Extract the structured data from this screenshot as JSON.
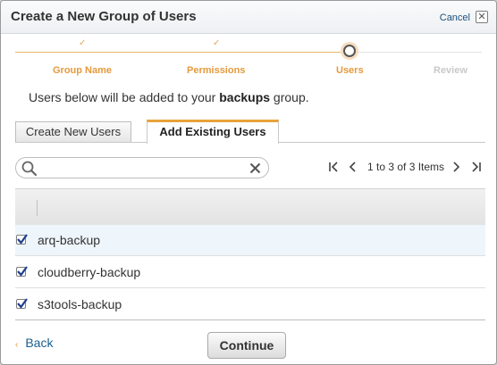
{
  "dialog": {
    "title": "Create a New Group of Users",
    "cancel_label": "Cancel"
  },
  "wizard": {
    "steps": [
      {
        "label": "Group Name",
        "state": "done"
      },
      {
        "label": "Permissions",
        "state": "done"
      },
      {
        "label": "Users",
        "state": "current"
      },
      {
        "label": "Review",
        "state": "todo"
      }
    ],
    "check_glyph": "✓"
  },
  "info": {
    "prefix": "Users below will be added to your ",
    "group_name": "backups",
    "suffix": " group."
  },
  "tabs": [
    {
      "label": "Create New Users",
      "active": false
    },
    {
      "label": "Add Existing Users",
      "active": true
    }
  ],
  "search": {
    "value": "",
    "placeholder": ""
  },
  "pager": {
    "text": "1 to 3 of 3 Items"
  },
  "users": [
    {
      "name": "arq-backup",
      "checked": true
    },
    {
      "name": "cloudberry-backup",
      "checked": true
    },
    {
      "name": "s3tools-backup",
      "checked": true
    }
  ],
  "footer": {
    "back_label": "Back",
    "back_arrow": "‹",
    "continue_label": "Continue"
  },
  "colors": {
    "accent_orange": "#e49a3c",
    "link_blue": "#1a5f8f",
    "checkbox_blue": "#1e3f8c"
  }
}
